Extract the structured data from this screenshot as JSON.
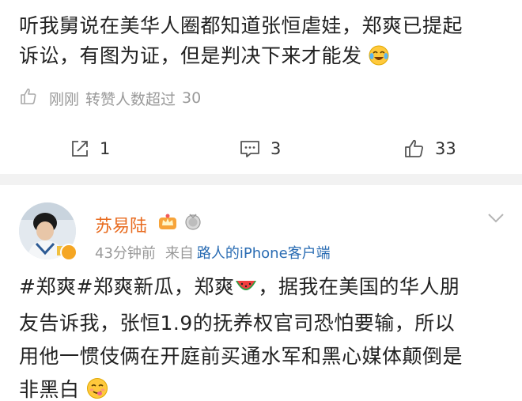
{
  "post1": {
    "text_line1": "听我舅说在美华人圈都知道张恒虐娃，郑爽已提起",
    "text_line2": "诉讼，有图为证，但是判决下来才能发",
    "meta_time": "刚刚",
    "meta_reposts": "转赞人数超过",
    "meta_count": "30",
    "repost_count": "1",
    "comment_count": "3",
    "like_count": "33",
    "icons": [
      "like-outline-icon",
      "repost-icon",
      "comment-icon",
      "like-icon",
      "laugh-cry-emoji"
    ]
  },
  "post2": {
    "username": "苏易陆",
    "time": "43分钟前",
    "from_label": "来自",
    "source": "路人的iPhone客户端",
    "line1_a": "#郑爽#郑爽新瓜，郑爽",
    "line1_b": "，据我在美国的华人朋",
    "line2": "友告诉我，张恒1.9的抚养权官司恐怕要输，所以",
    "line3": "用他一惯伎俩在开庭前买通水军和黑心媒体颠倒是",
    "line4": "非黑白",
    "icons": [
      "avatar",
      "verified-badge",
      "crown-badge",
      "medal-badge",
      "chevron-down-icon",
      "watermelon-emoji",
      "yummy-emoji"
    ]
  }
}
